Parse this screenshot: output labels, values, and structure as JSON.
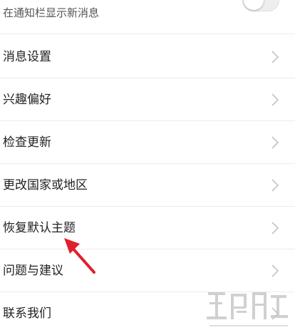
{
  "notification": {
    "subtitle": "在通知栏显示新消息",
    "toggle_on": false
  },
  "menu": {
    "items": [
      {
        "label": "消息设置"
      },
      {
        "label": "兴趣偏好"
      },
      {
        "label": "检查更新"
      },
      {
        "label": "更改国家或地区"
      },
      {
        "label": "恢复默认主题"
      },
      {
        "label": "问题与建议"
      },
      {
        "label": "联系我们"
      }
    ]
  },
  "annotation": {
    "arrow_color": "#e0202a"
  },
  "watermark": {
    "icon": "watermark-logo-icon"
  },
  "colors": {
    "divider": "#ececec",
    "chevron": "#c4c4c4",
    "text": "#222222"
  }
}
